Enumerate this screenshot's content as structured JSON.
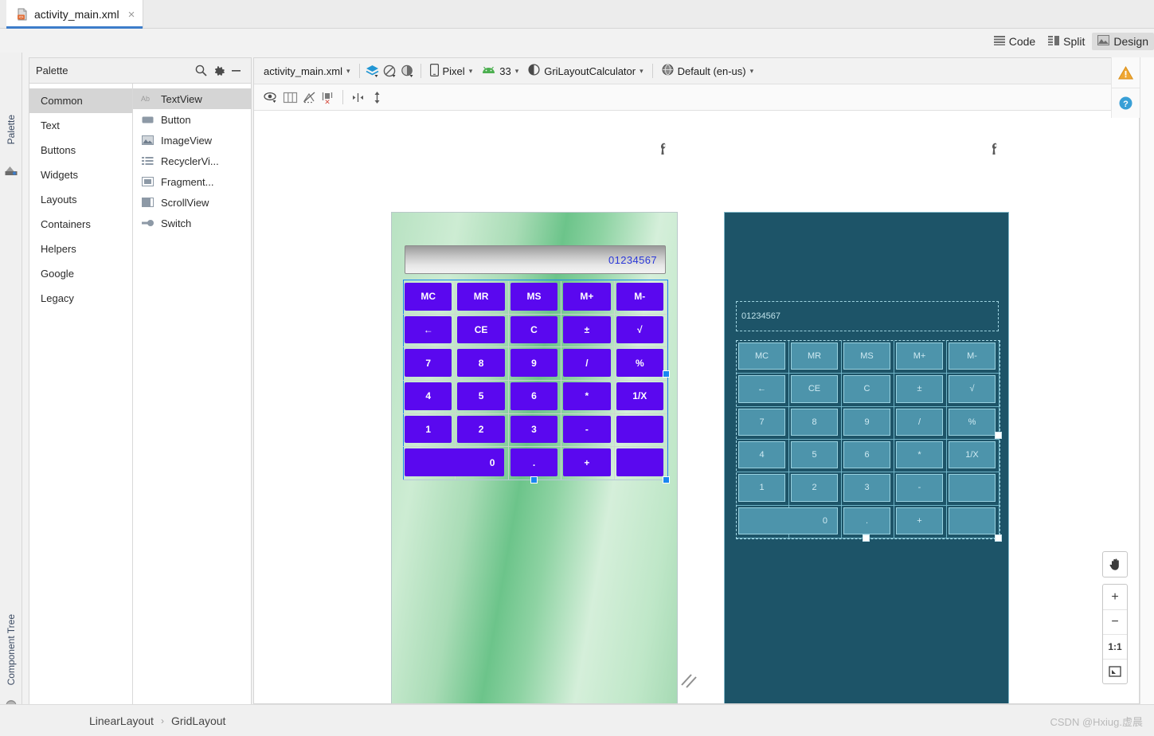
{
  "tab": {
    "title": "activity_main.xml",
    "icon": "xml-file-icon",
    "close": "×"
  },
  "editor_modes": [
    {
      "label": "Code",
      "icon": "code-lines-icon",
      "active": false
    },
    {
      "label": "Split",
      "icon": "split-view-icon",
      "active": false
    },
    {
      "label": "Design",
      "icon": "design-image-icon",
      "active": true
    }
  ],
  "left_strips": [
    {
      "label": "Palette",
      "icon": "palette-icon"
    },
    {
      "label": "Component Tree",
      "icon": "component-tree-icon"
    }
  ],
  "palette": {
    "title": "Palette",
    "actions": [
      {
        "name": "search-icon",
        "glyph": "⚲"
      },
      {
        "name": "gear-icon",
        "glyph": "⚙"
      },
      {
        "name": "minimize-icon",
        "glyph": "−"
      }
    ],
    "categories": [
      {
        "label": "Common",
        "selected": true
      },
      {
        "label": "Text",
        "selected": false
      },
      {
        "label": "Buttons",
        "selected": false
      },
      {
        "label": "Widgets",
        "selected": false
      },
      {
        "label": "Layouts",
        "selected": false
      },
      {
        "label": "Containers",
        "selected": false
      },
      {
        "label": "Helpers",
        "selected": false
      },
      {
        "label": "Google",
        "selected": false
      },
      {
        "label": "Legacy",
        "selected": false
      }
    ],
    "widgets": [
      {
        "label": "TextView",
        "icon": "textview-icon",
        "selected": true
      },
      {
        "label": "Button",
        "icon": "button-icon",
        "selected": false
      },
      {
        "label": "ImageView",
        "icon": "imageview-icon",
        "selected": false
      },
      {
        "label": "RecyclerVi...",
        "icon": "recyclerview-icon",
        "selected": false
      },
      {
        "label": "Fragment...",
        "icon": "fragment-icon",
        "selected": false
      },
      {
        "label": "ScrollView",
        "icon": "scrollview-icon",
        "selected": false
      },
      {
        "label": "Switch",
        "icon": "switch-icon",
        "selected": false
      }
    ]
  },
  "design_toolbar": {
    "file": "activity_main.xml",
    "device": "Pixel",
    "api_level": "33",
    "theme": "GriLayoutCalculator",
    "locale": "Default (en-us)",
    "icons": [
      {
        "name": "design-surface-mode-icon"
      },
      {
        "name": "orientation-icon"
      },
      {
        "name": "night-mode-icon"
      }
    ],
    "row2_icons": [
      {
        "name": "view-options-eye-icon"
      },
      {
        "name": "grid-columns-icon"
      },
      {
        "name": "hide-constraints-icon"
      },
      {
        "name": "clear-constraints-icon"
      },
      {
        "name": "align-horizontal-icon"
      },
      {
        "name": "expand-vertical-icon"
      }
    ],
    "warning_icon": "warning-triangle-icon",
    "help_icon": "help-circle-icon"
  },
  "calculator": {
    "display_value": "01234567",
    "keys": [
      {
        "label": "MC",
        "span": 1
      },
      {
        "label": "MR",
        "span": 1
      },
      {
        "label": "MS",
        "span": 1
      },
      {
        "label": "M+",
        "span": 1
      },
      {
        "label": "M-",
        "span": 1
      },
      {
        "label": "←",
        "span": 1
      },
      {
        "label": "CE",
        "span": 1
      },
      {
        "label": "C",
        "span": 1
      },
      {
        "label": "±",
        "span": 1
      },
      {
        "label": "√",
        "span": 1
      },
      {
        "label": "7",
        "span": 1
      },
      {
        "label": "8",
        "span": 1
      },
      {
        "label": "9",
        "span": 1
      },
      {
        "label": "/",
        "span": 1
      },
      {
        "label": "%",
        "span": 1
      },
      {
        "label": "4",
        "span": 1
      },
      {
        "label": "5",
        "span": 1
      },
      {
        "label": "6",
        "span": 1
      },
      {
        "label": "*",
        "span": 1
      },
      {
        "label": "1/X",
        "span": 1
      },
      {
        "label": "1",
        "span": 1
      },
      {
        "label": "2",
        "span": 1
      },
      {
        "label": "3",
        "span": 1
      },
      {
        "label": "-",
        "span": 1
      },
      {
        "label": "",
        "span": 1
      },
      {
        "label": "0",
        "span": 2,
        "align": "right"
      },
      {
        "label": ".",
        "span": 1
      },
      {
        "label": "+",
        "span": 1
      },
      {
        "label": "",
        "span": 1
      }
    ]
  },
  "zoom_controls": [
    {
      "name": "pan-hand-button",
      "glyph": "✋"
    },
    {
      "name": "zoom-in-button",
      "glyph": "+"
    },
    {
      "name": "zoom-out-button",
      "glyph": "−"
    },
    {
      "name": "zoom-actual-size-button",
      "glyph": "1:1"
    },
    {
      "name": "zoom-fit-button",
      "glyph": "⛶"
    }
  ],
  "breadcrumb": [
    {
      "label": "LinearLayout"
    },
    {
      "label": "GridLayout"
    }
  ],
  "breadcrumb_separator": "›",
  "watermark": "CSDN @Hxiug.虚晨",
  "colors": {
    "button_purple": "#5a08ef",
    "display_text_blue": "#2a37d8",
    "blueprint_bg": "#1d5468",
    "blueprint_fill": "#4d94ab",
    "selection_blue": "#1a86f0",
    "tab_underline": "#3d7dca"
  }
}
